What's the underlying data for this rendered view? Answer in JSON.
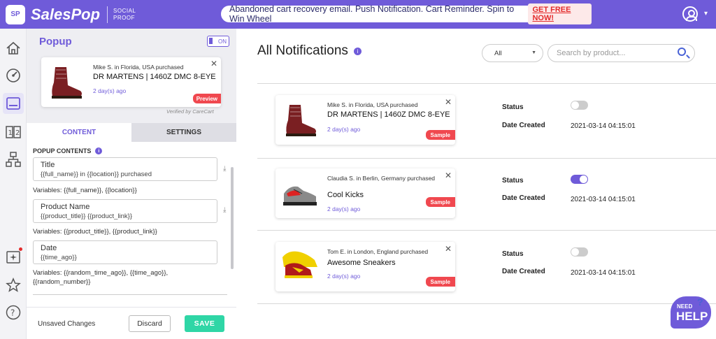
{
  "header": {
    "logo_badge": "SP",
    "logo_name": "SalesPop",
    "logo_sub_line1": "SOCIAL",
    "logo_sub_line2": "PROOF",
    "promo_text": "Abandoned cart recovery email. Push Notification. Cart Reminder. Spin to Win Wheel",
    "promo_cta": "GET FREE NOW!"
  },
  "sidebar": {
    "items": [
      {
        "icon": "home-icon"
      },
      {
        "icon": "speedometer-icon"
      },
      {
        "icon": "popup-icon",
        "active": true
      },
      {
        "icon": "counter-icon"
      },
      {
        "icon": "sitemap-icon"
      },
      {
        "icon": "new-feature-icon",
        "has_dot": true
      },
      {
        "icon": "star-icon"
      },
      {
        "icon": "help-circle-icon"
      }
    ]
  },
  "editor": {
    "title": "Popup",
    "toggle_label": "ON",
    "preview_card": {
      "who": "Mike S. in Florida, USA purchased",
      "product": "DR MARTENS | 1460Z DMC 8-EYE ...",
      "ago": "2 day(s) ago",
      "badge": "Preview"
    },
    "verified": "Verified by CareCart",
    "tabs": [
      "CONTENT",
      "SETTINGS"
    ],
    "section_title": "POPUP CONTENTS",
    "fields": [
      {
        "label": "Title",
        "value": "{{full_name}} in {{location}} purchased",
        "vars": "Variables: {{full_name}}, {{location}}"
      },
      {
        "label": "Product Name",
        "value": "{{product_title}} {{product_link}}",
        "vars": "Variables: {{product_title}}, {{product_link}}"
      },
      {
        "label": "Date",
        "value": "{{time_ago}}",
        "vars": "Variables: {{random_time_ago}}, {{time_ago}}, {{random_number}}"
      }
    ],
    "unsaved_label": "Unsaved Changes",
    "discard_label": "Discard",
    "save_label": "SAVE"
  },
  "main": {
    "title": "All Notifications",
    "filter_value": "All",
    "search_placeholder": "Search by product...",
    "status_label": "Status",
    "date_label": "Date Created",
    "notifications": [
      {
        "who": "Mike S. in Florida, USA purchased",
        "product": "DR MARTENS | 1460Z DMC 8-EYE ...",
        "ago": "2 day(s) ago",
        "badge": "Sample",
        "enabled": false,
        "date": "2021-03-14 04:15:01",
        "image": "boot"
      },
      {
        "who": "Claudia S. in Berlin, Germany purchased",
        "product": "Cool Kicks",
        "ago": "2 day(s) ago",
        "badge": "Sample",
        "enabled": true,
        "date": "2021-03-14 04:15:01",
        "image": "sneaker-grey"
      },
      {
        "who": "Tom E. in London, England purchased",
        "product": "Awesome Sneakers",
        "ago": "2 day(s) ago",
        "badge": "Sample",
        "enabled": false,
        "date": "2021-03-14 04:15:01",
        "image": "sneaker-yellow"
      }
    ]
  },
  "help_widget": {
    "line1": "NEED",
    "line2": "HELP",
    "mark": "?"
  },
  "colors": {
    "brand": "#6f5bd9",
    "save": "#2fd6a6",
    "badge": "#f0484f"
  }
}
